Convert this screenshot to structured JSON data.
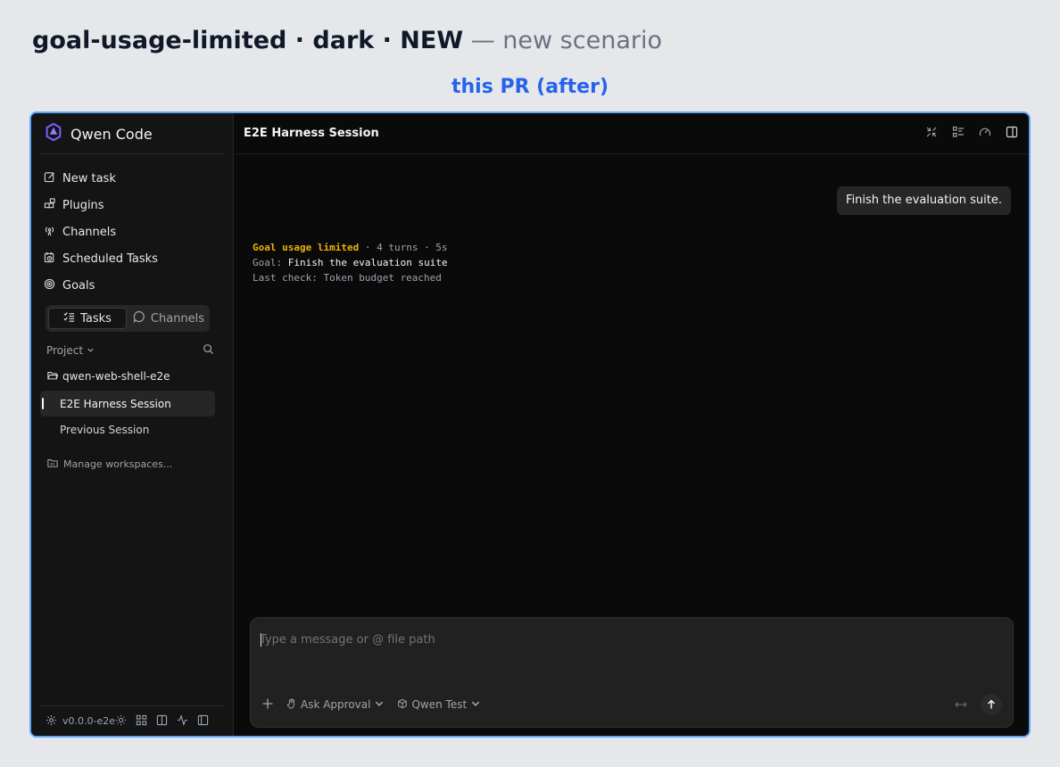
{
  "heading": {
    "scenario": "goal-usage-limited · dark · NEW",
    "suffix": " — new scenario"
  },
  "pr_label": "this PR (after)",
  "sidebar": {
    "brand": "Qwen Code",
    "nav": [
      {
        "label": "New task",
        "icon": "edit-icon"
      },
      {
        "label": "Plugins",
        "icon": "plugins-icon"
      },
      {
        "label": "Channels",
        "icon": "broadcast-icon"
      },
      {
        "label": "Scheduled Tasks",
        "icon": "calendar-clock-icon"
      },
      {
        "label": "Goals",
        "icon": "target-icon"
      }
    ],
    "segment": {
      "tasks": "Tasks",
      "channels": "Channels",
      "active": "Tasks"
    },
    "project_label": "Project",
    "workspace": "qwen-web-shell-e2e",
    "sessions": [
      {
        "label": "E2E Harness Session",
        "active": true
      },
      {
        "label": "Previous Session",
        "active": false
      }
    ],
    "manage": "Manage workspaces...",
    "version": "v0.0.0-e2e"
  },
  "main": {
    "title": "E2E Harness Session",
    "user_message": "Finish the evaluation suite.",
    "goal": {
      "status": "Goal usage limited",
      "meta": " · 4 turns · 5s",
      "goal_label": "Goal: ",
      "goal_value": "Finish the evaluation suite",
      "last_check": "Last check: Token budget reached"
    },
    "composer": {
      "placeholder": "Type a message or @ file path",
      "approval": "Ask Approval",
      "model": "Qwen Test"
    }
  },
  "colors": {
    "accent": "#2563eb",
    "goal_status": "#eab308",
    "frame_border": "#60a5fa",
    "brand_icon": "#7c5cff"
  }
}
